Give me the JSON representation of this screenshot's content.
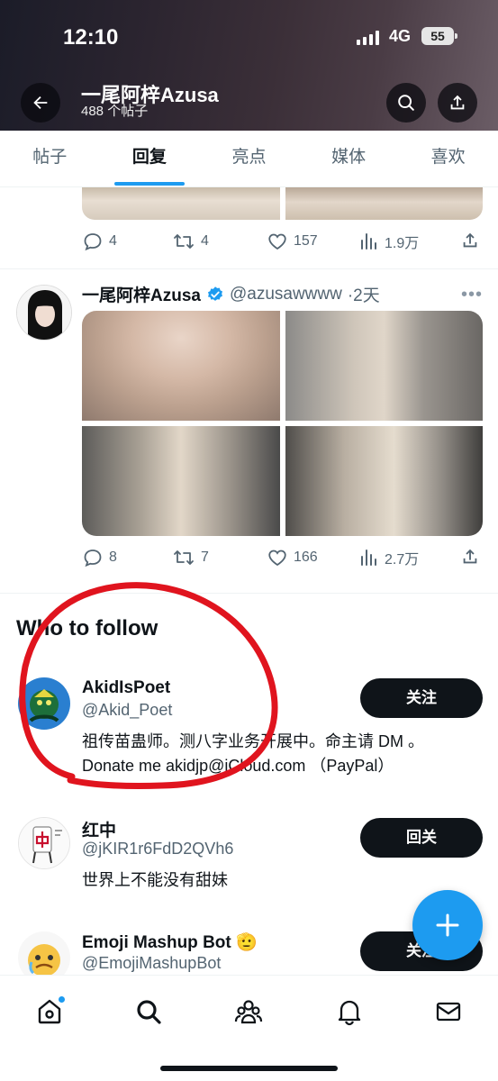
{
  "status_bar": {
    "time": "12:10",
    "network": "4G",
    "battery": "55"
  },
  "header": {
    "title": "一尾阿梓Azusa",
    "subtitle": "488 个帖子",
    "back_icon": "arrow-left-icon",
    "search_icon": "search-icon",
    "share_icon": "share-icon"
  },
  "tabs": [
    {
      "label": "帖子",
      "active": false
    },
    {
      "label": "回复",
      "active": true
    },
    {
      "label": "亮点",
      "active": false
    },
    {
      "label": "媒体",
      "active": false
    },
    {
      "label": "喜欢",
      "active": false
    }
  ],
  "prev_tweet": {
    "replies": "4",
    "retweets": "4",
    "likes": "157",
    "views": "1.9万"
  },
  "tweet": {
    "name": "一尾阿梓Azusa",
    "handle": "@azusawwww",
    "time": "·2天",
    "replies": "8",
    "retweets": "7",
    "likes": "166",
    "views": "2.7万"
  },
  "who_to_follow": {
    "title": "Who to follow",
    "accounts": [
      {
        "name": "AkidIsPoet",
        "handle": "@Akid_Poet",
        "bio_line1": "祖传苗蛊师。测八字业务开展中。命主请 DM 。",
        "bio_line2": "Donate me akidjp@iCloud.com （PayPal）",
        "button": "关注"
      },
      {
        "name": "红中",
        "handle": "@jKIR1r6FdD2QVh6",
        "bio_line1": "世界上不能没有甜妹",
        "button": "回关"
      },
      {
        "name": "Emoji Mashup Bot 🫡",
        "handle": "@EmojiMashupBot",
        "button": "关注"
      }
    ]
  },
  "fab": {
    "icon": "plus-icon"
  },
  "bottom_nav": [
    "home-icon",
    "search-icon",
    "communities-icon",
    "notifications-icon",
    "messages-icon"
  ],
  "colors": {
    "accent": "#1d9bf0",
    "annotation": "#e0141e",
    "text": "#0f1419",
    "muted": "#536471"
  }
}
